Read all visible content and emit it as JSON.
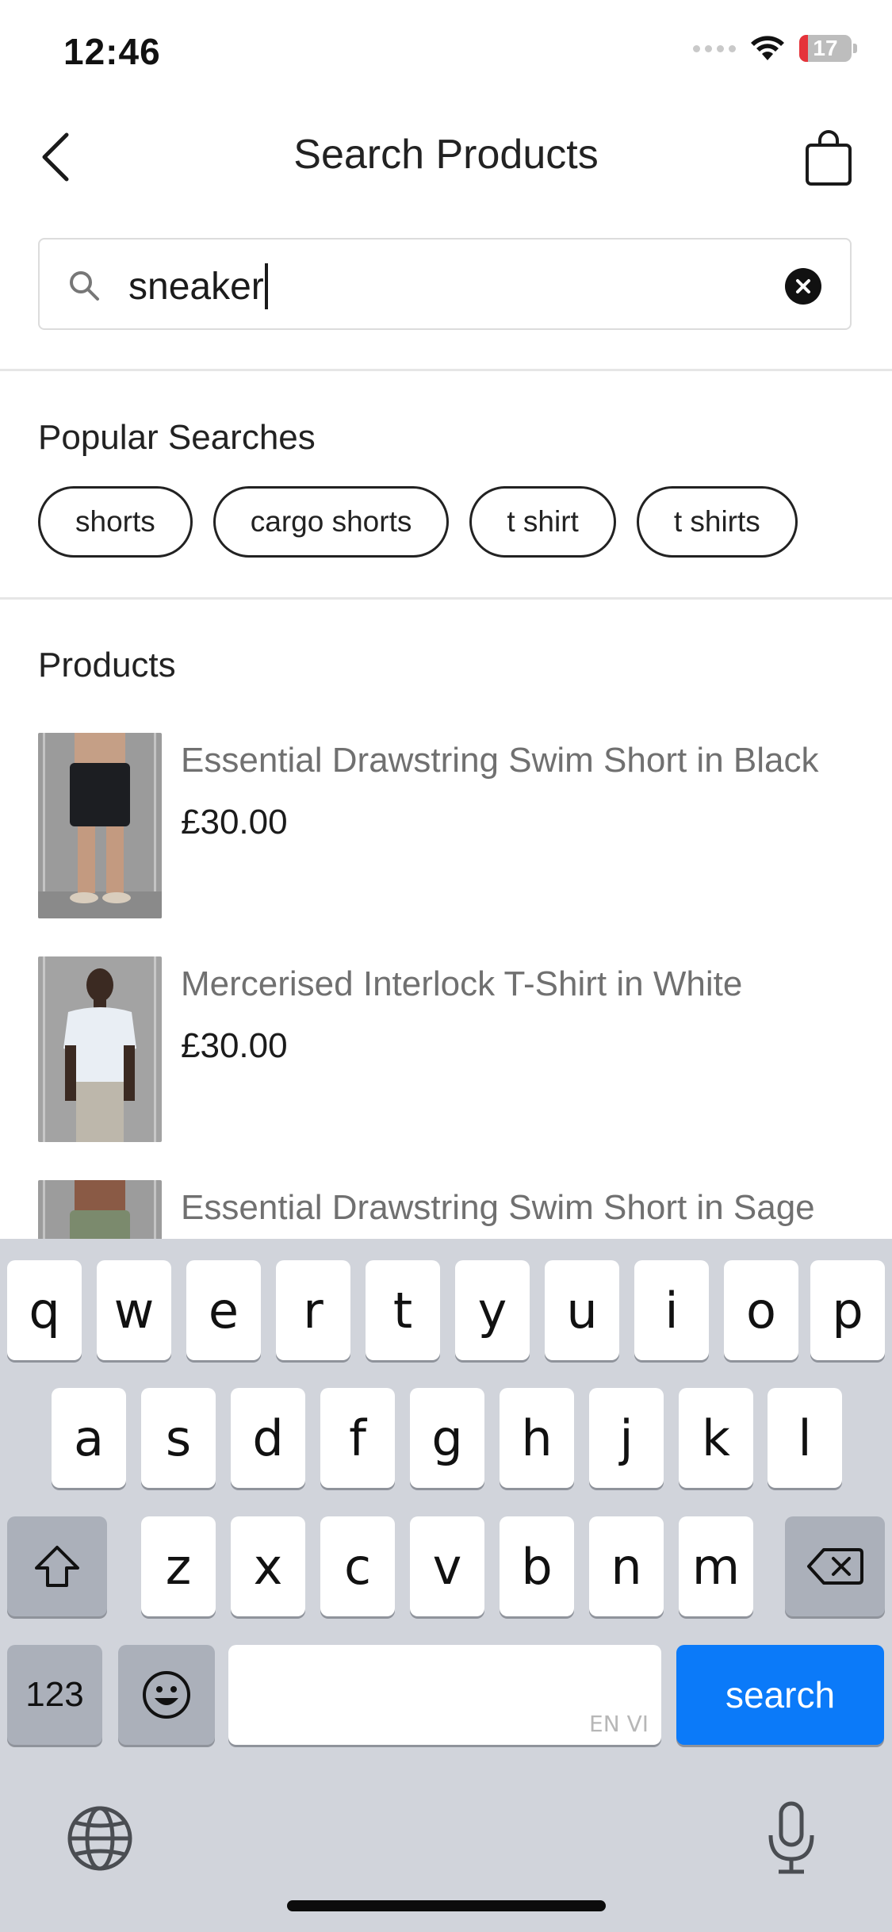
{
  "status_bar": {
    "time": "12:46",
    "battery_level": "17"
  },
  "nav": {
    "title": "Search Products"
  },
  "search": {
    "value": "sneaker"
  },
  "popular": {
    "title": "Popular Searches",
    "chips": [
      "shorts",
      "cargo shorts",
      "t shirt",
      "t shirts"
    ]
  },
  "products": {
    "title": "Products",
    "items": [
      {
        "name": "Essential Drawstring Swim Short in Black",
        "price": "£30.00"
      },
      {
        "name": "Mercerised Interlock T-Shirt in White",
        "price": "£30.00"
      },
      {
        "name": "Essential Drawstring Swim Short in Sage",
        "price": ""
      }
    ]
  },
  "keyboard": {
    "row1": [
      "q",
      "w",
      "e",
      "r",
      "t",
      "y",
      "u",
      "i",
      "o",
      "p"
    ],
    "row2": [
      "a",
      "s",
      "d",
      "f",
      "g",
      "h",
      "j",
      "k",
      "l"
    ],
    "row3": [
      "z",
      "x",
      "c",
      "v",
      "b",
      "n",
      "m"
    ],
    "numbers_label": "123",
    "action_label": "search",
    "space_hint": "EN VI"
  },
  "colors": {
    "accent": "#0b7af9",
    "keyboard_bg": "#d1d4db"
  }
}
